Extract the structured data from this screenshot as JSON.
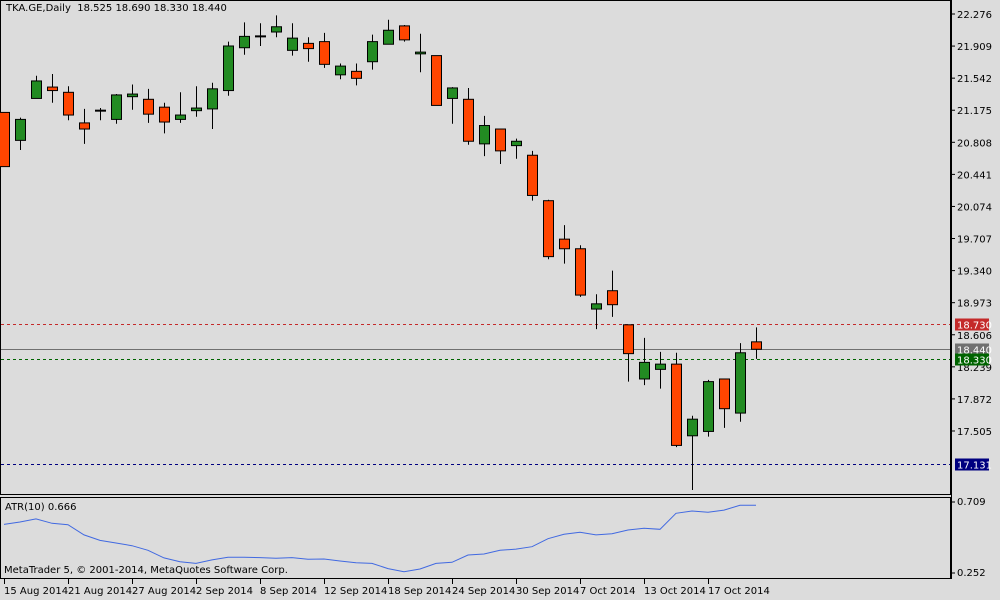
{
  "header": {
    "symbol": "TKA.GE,Daily",
    "open": "18.525",
    "high": "18.690",
    "low": "18.330",
    "close": "18.440"
  },
  "colors": {
    "bull": "#228b22",
    "bear": "#ff4500",
    "background": "#dcdcdc",
    "atr_line": "#4169e1",
    "ask_line": "#cc0000",
    "bid_line": "#006400",
    "last_line": "#707070",
    "level_line": "#000080"
  },
  "price_axis": {
    "ticks": [
      "22.276",
      "21.909",
      "21.542",
      "21.175",
      "20.808",
      "20.441",
      "20.074",
      "19.707",
      "19.340",
      "18.973",
      "18.606",
      "18.239",
      "17.872",
      "17.505"
    ]
  },
  "price_lines": [
    {
      "name": "ask",
      "value": "18.730",
      "label": "18.730",
      "color": "#c42a2a",
      "style": "dashed"
    },
    {
      "name": "last",
      "value": "18.440",
      "label": "18.440",
      "color": "#707070",
      "style": "solid"
    },
    {
      "name": "bid",
      "value": "18.330",
      "label": "18.330",
      "color": "#006400",
      "style": "dashed"
    },
    {
      "name": "level",
      "value": "17.131",
      "label": "17.131",
      "color": "#000080",
      "style": "dashed"
    }
  ],
  "indicator": {
    "label": "ATR(10) 0.666",
    "axis_max": "0.709",
    "axis_min": "0.252",
    "copyright": "MetaTrader 5, © 2001-2014, MetaQuotes Software Corp."
  },
  "time_axis": {
    "labels": [
      {
        "text": "15 Aug 2014",
        "bar": 0
      },
      {
        "text": "21 Aug 2014",
        "bar": 4
      },
      {
        "text": "27 Aug 2014",
        "bar": 8
      },
      {
        "text": "2 Sep 2014",
        "bar": 12
      },
      {
        "text": "8 Sep 2014",
        "bar": 16
      },
      {
        "text": "12 Sep 2014",
        "bar": 20
      },
      {
        "text": "18 Sep 2014",
        "bar": 24
      },
      {
        "text": "24 Sep 2014",
        "bar": 28
      },
      {
        "text": "30 Sep 2014",
        "bar": 32
      },
      {
        "text": "7 Oct 2014",
        "bar": 36
      },
      {
        "text": "13 Oct 2014",
        "bar": 40
      },
      {
        "text": "17 Oct 2014",
        "bar": 44
      }
    ]
  },
  "chart_data": {
    "type": "candlestick",
    "title": "TKA.GE,Daily",
    "ylim": [
      16.8,
      22.4
    ],
    "ohlc": [
      [
        21.15,
        21.15,
        20.53,
        20.53
      ],
      [
        20.83,
        21.09,
        20.72,
        21.07
      ],
      [
        21.31,
        21.57,
        21.31,
        21.51
      ],
      [
        21.44,
        21.59,
        21.26,
        21.4
      ],
      [
        21.38,
        21.45,
        21.06,
        21.12
      ],
      [
        21.03,
        21.19,
        20.79,
        20.96
      ],
      [
        21.17,
        21.2,
        21.06,
        21.17
      ],
      [
        21.07,
        21.36,
        21.02,
        21.35
      ],
      [
        21.33,
        21.47,
        21.18,
        21.36
      ],
      [
        21.3,
        21.42,
        21.03,
        21.13
      ],
      [
        21.21,
        21.26,
        20.91,
        21.04
      ],
      [
        21.07,
        21.38,
        21.03,
        21.12
      ],
      [
        21.17,
        21.45,
        21.1,
        21.2
      ],
      [
        21.19,
        21.49,
        20.96,
        21.42
      ],
      [
        21.4,
        21.96,
        21.34,
        21.91
      ],
      [
        21.89,
        22.18,
        21.81,
        22.02
      ],
      [
        22.02,
        22.17,
        21.91,
        22.02
      ],
      [
        22.07,
        22.26,
        22.01,
        22.13
      ],
      [
        21.86,
        22.17,
        21.8,
        22.0
      ],
      [
        21.94,
        22.01,
        21.73,
        21.88
      ],
      [
        21.96,
        22.06,
        21.66,
        21.7
      ],
      [
        21.58,
        21.71,
        21.53,
        21.68
      ],
      [
        21.62,
        21.71,
        21.46,
        21.54
      ],
      [
        21.73,
        22.04,
        21.64,
        21.96
      ],
      [
        21.93,
        22.21,
        21.93,
        22.09
      ],
      [
        22.14,
        22.15,
        21.96,
        21.98
      ],
      [
        21.82,
        22.05,
        21.61,
        21.84
      ],
      [
        21.8,
        21.8,
        21.23,
        21.23
      ],
      [
        21.31,
        21.44,
        21.02,
        21.43
      ],
      [
        21.3,
        21.43,
        20.78,
        20.82
      ],
      [
        20.79,
        21.11,
        20.65,
        21.0
      ],
      [
        20.96,
        20.96,
        20.56,
        20.71
      ],
      [
        20.77,
        20.85,
        20.62,
        20.82
      ],
      [
        20.66,
        20.71,
        20.14,
        20.2
      ],
      [
        20.14,
        20.15,
        19.47,
        19.5
      ],
      [
        19.7,
        19.86,
        19.42,
        19.59
      ],
      [
        19.59,
        19.63,
        19.04,
        19.06
      ],
      [
        18.9,
        19.07,
        18.67,
        18.96
      ],
      [
        19.11,
        19.34,
        18.81,
        18.95
      ],
      [
        18.72,
        18.72,
        18.07,
        18.39
      ],
      [
        18.1,
        18.57,
        18.03,
        18.29
      ],
      [
        18.21,
        18.41,
        17.99,
        18.27
      ],
      [
        18.27,
        18.4,
        17.32,
        17.34
      ],
      [
        17.45,
        17.68,
        16.83,
        17.64
      ],
      [
        17.5,
        18.09,
        17.44,
        18.07
      ],
      [
        18.1,
        18.1,
        17.54,
        17.76
      ],
      [
        17.71,
        18.51,
        17.61,
        18.4
      ],
      [
        18.525,
        18.69,
        18.33,
        18.44
      ]
    ],
    "atr": [
      0.565,
      0.58,
      0.6,
      0.572,
      0.563,
      0.497,
      0.462,
      0.445,
      0.428,
      0.398,
      0.349,
      0.325,
      0.314,
      0.336,
      0.353,
      0.353,
      0.351,
      0.347,
      0.351,
      0.34,
      0.342,
      0.329,
      0.318,
      0.314,
      0.28,
      0.26,
      0.278,
      0.314,
      0.321,
      0.368,
      0.374,
      0.398,
      0.406,
      0.421,
      0.473,
      0.501,
      0.514,
      0.497,
      0.505,
      0.529,
      0.54,
      0.533,
      0.636,
      0.651,
      0.643,
      0.657,
      0.688,
      0.688
    ],
    "atr_ylim": [
      0.252,
      0.709
    ]
  }
}
